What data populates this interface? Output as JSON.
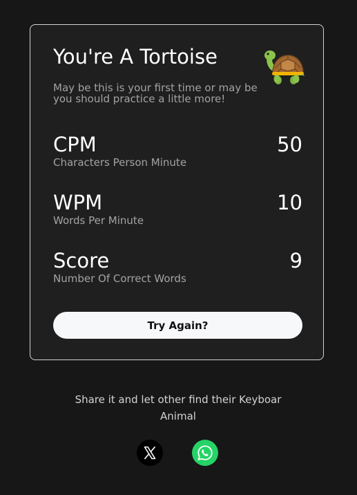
{
  "result": {
    "title": "You're A Tortoise",
    "animal_icon": "tortoise-icon",
    "subtitle": "May be this is your first time or may be you should practice a little more!"
  },
  "stats": [
    {
      "name": "CPM",
      "description": "Characters Person Minute",
      "value": "50"
    },
    {
      "name": "WPM",
      "description": "Words Per Minute",
      "value": "10"
    },
    {
      "name": "Score",
      "description": "Number Of Correct Words",
      "value": "9"
    }
  ],
  "actions": {
    "try_again_label": "Try Again?"
  },
  "share": {
    "text": "Share it and let other find their Keyboar Animal",
    "buttons": [
      {
        "icon": "x-logo-icon",
        "color": "#000000"
      },
      {
        "icon": "whatsapp-icon",
        "color": "#25d366"
      }
    ]
  },
  "colors": {
    "background": "#171717",
    "card": "#1f1f1f",
    "muted_text": "#a3a3a3"
  }
}
